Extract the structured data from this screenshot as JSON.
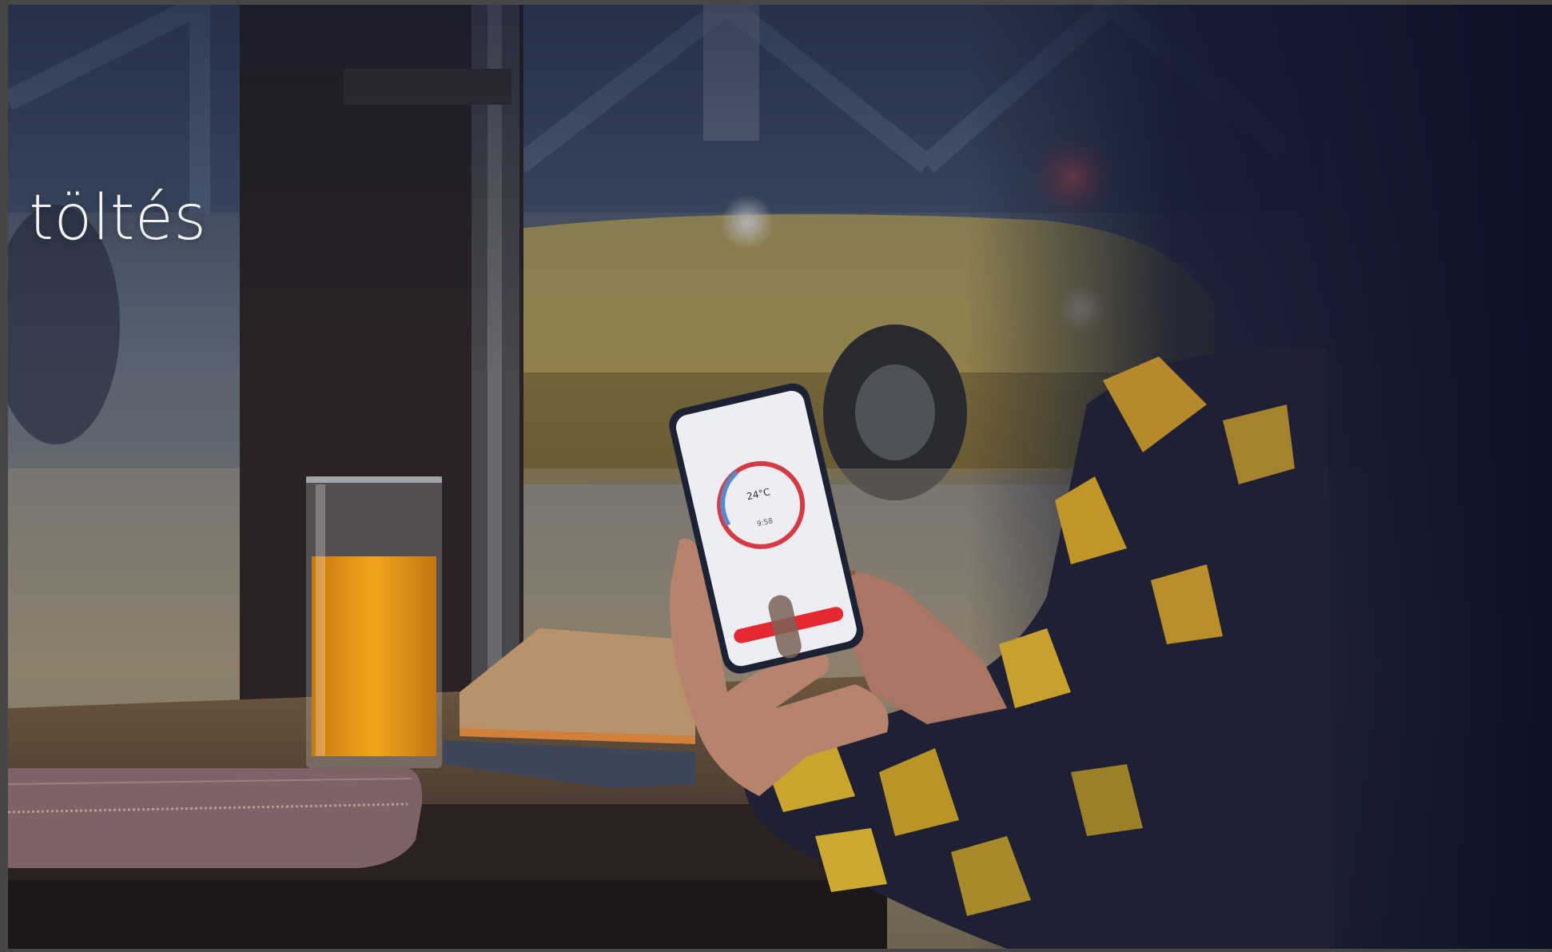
{
  "hero": {
    "headline": "t töltés"
  }
}
